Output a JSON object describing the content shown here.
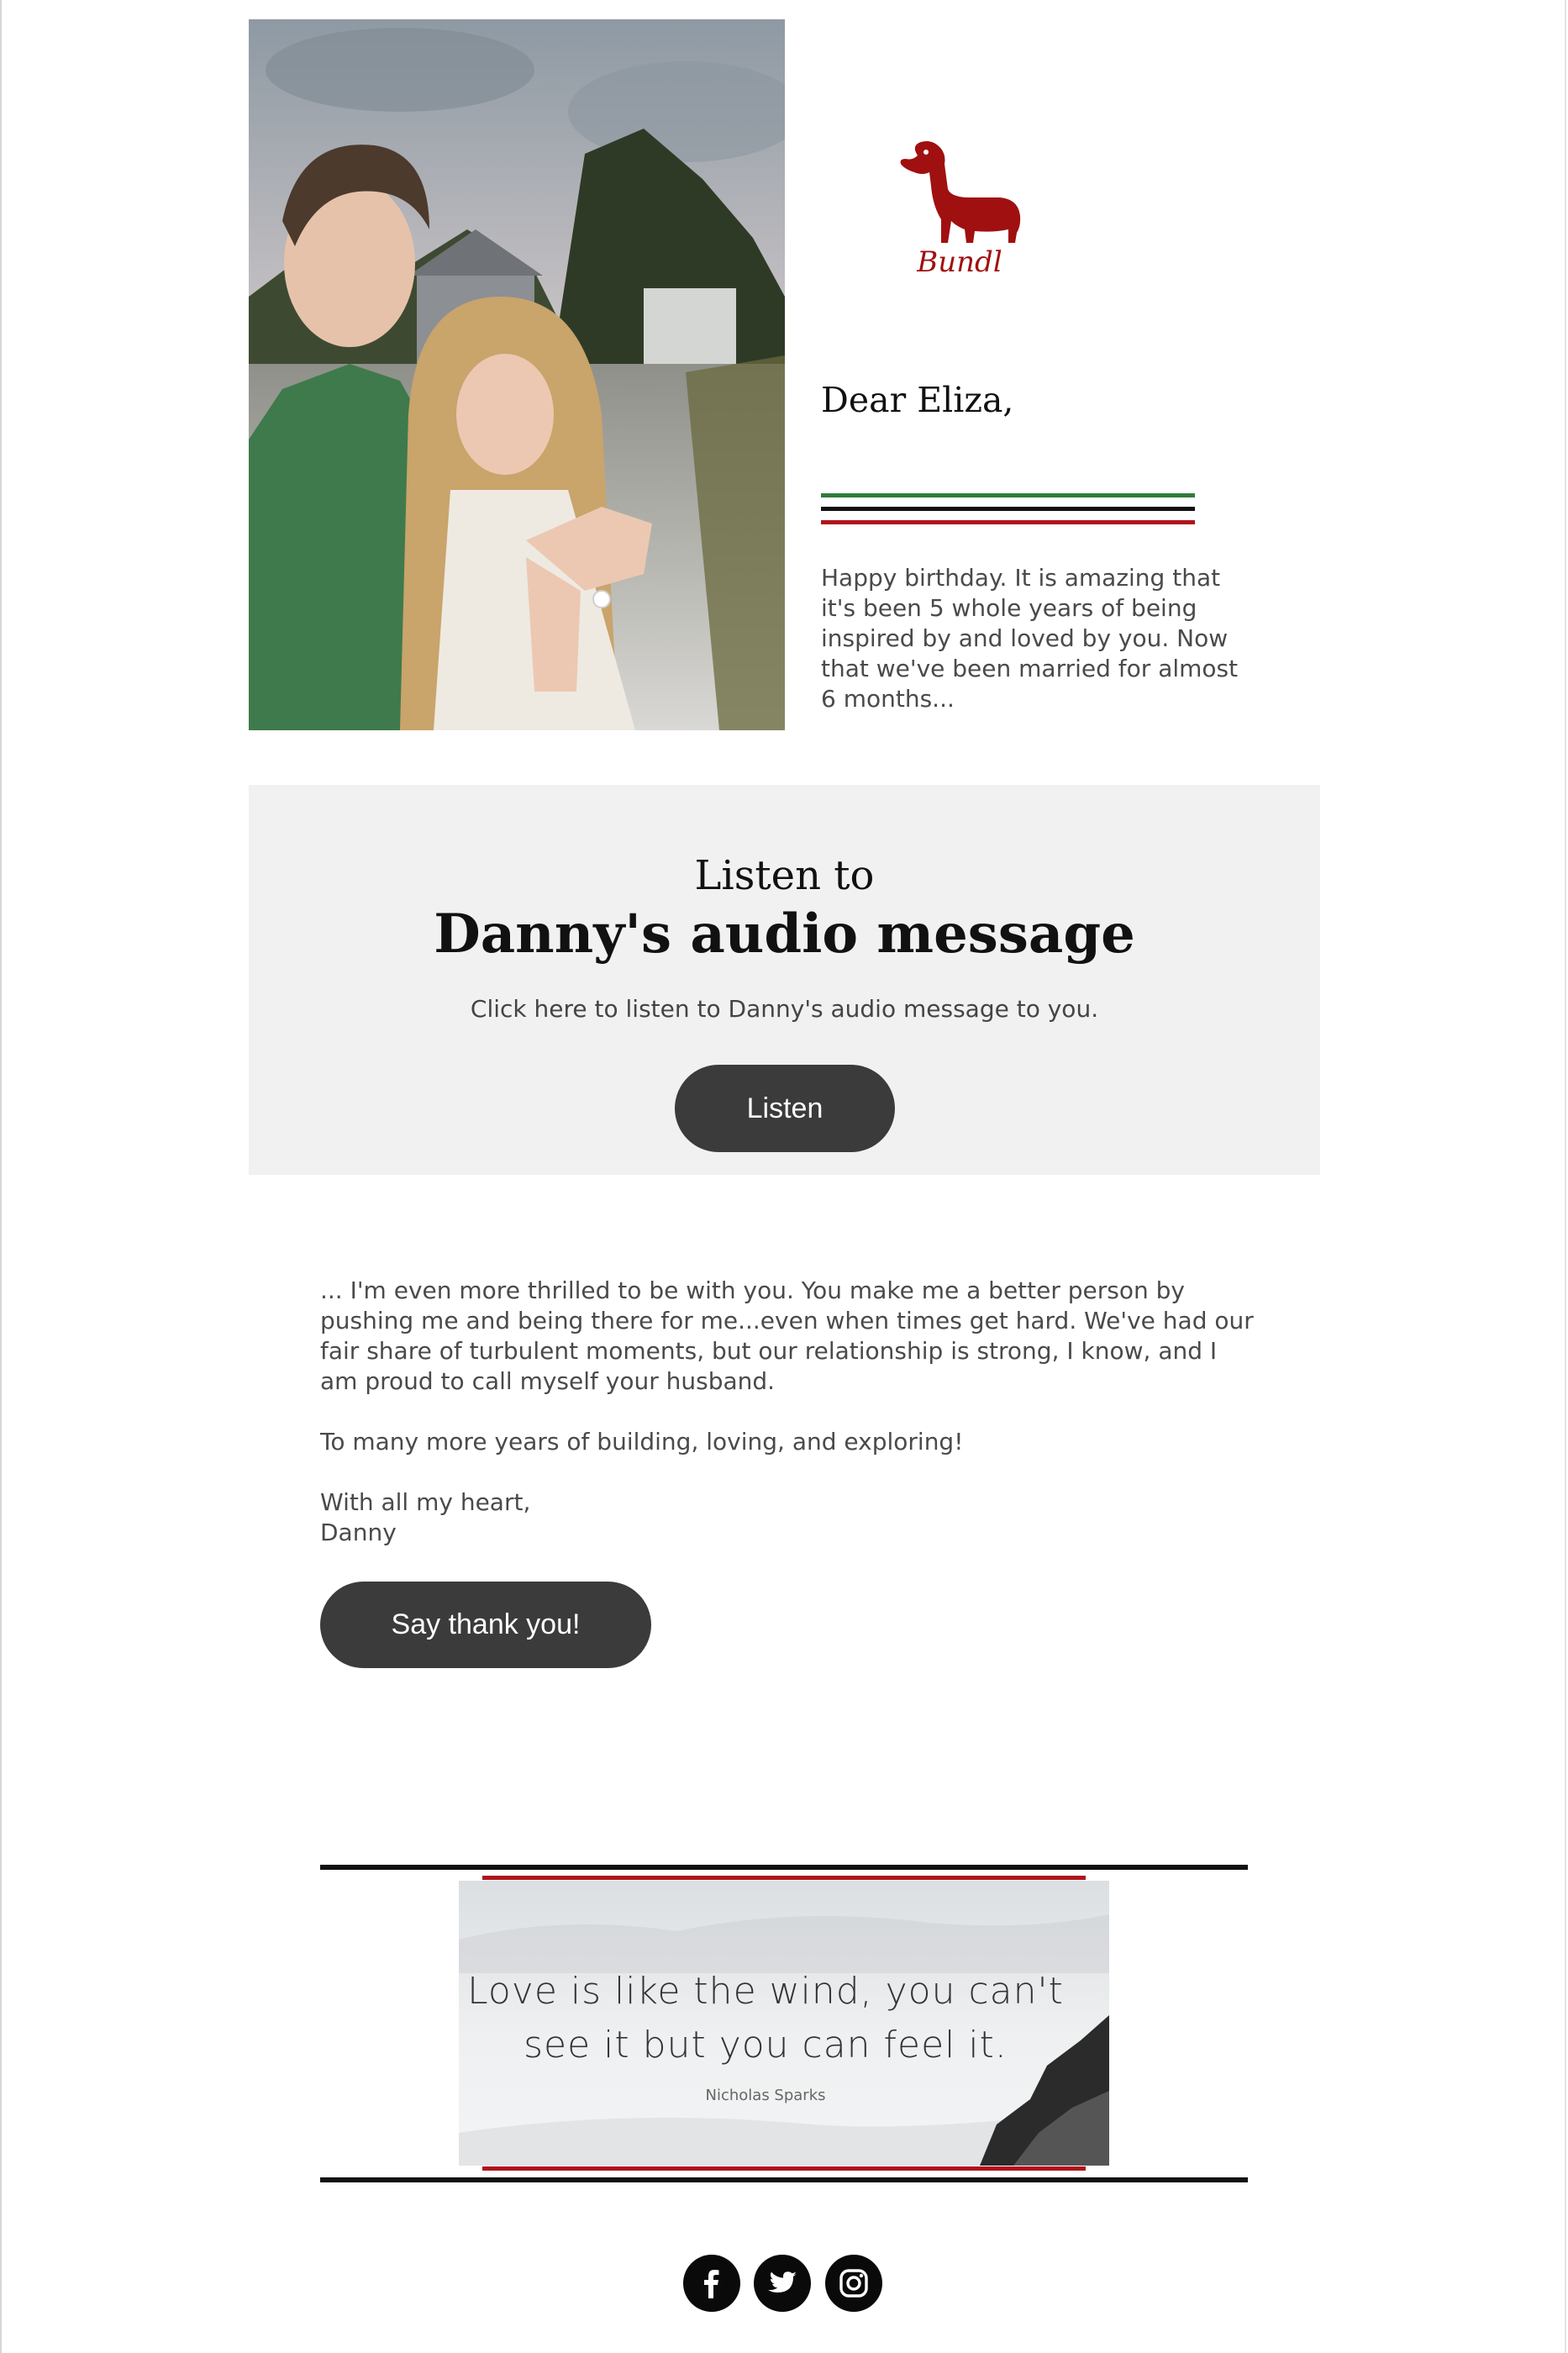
{
  "header": {
    "logo_text": "Bundl",
    "greeting": "Dear Eliza,",
    "intro": "Happy birthday. It is amazing that it's been 5 whole years of being inspired by and loved by you. Now that we've been married for almost 6 months..."
  },
  "audio": {
    "kicker": "Listen to",
    "title": "Danny's audio message",
    "description": "Click here to listen to Danny's audio message to you.",
    "button_label": "Listen"
  },
  "letter": {
    "paragraph_1": "... I'm even more thrilled to be with you. You make me a better person by pushing me and being there for me...even when times get hard. We've had our fair share of turbulent moments, but our relationship is strong, I know, and I am proud to call myself your husband.",
    "paragraph_2": "To many more years of building, loving, and exploring!",
    "closing": "With all my heart,",
    "signature": "Danny",
    "button_label": "Say thank you!"
  },
  "quote": {
    "line_1": "Love is like the wind, you can't",
    "line_2": "see it but you can feel it.",
    "author": "Nicholas Sparks"
  },
  "social": {
    "icons": [
      "facebook-icon",
      "twitter-icon",
      "instagram-icon"
    ]
  },
  "colors": {
    "accent_red": "#b0141b",
    "accent_green": "#2f7d3b",
    "button_bg": "#3b3b3b",
    "panel_bg": "#f1f1f1"
  }
}
